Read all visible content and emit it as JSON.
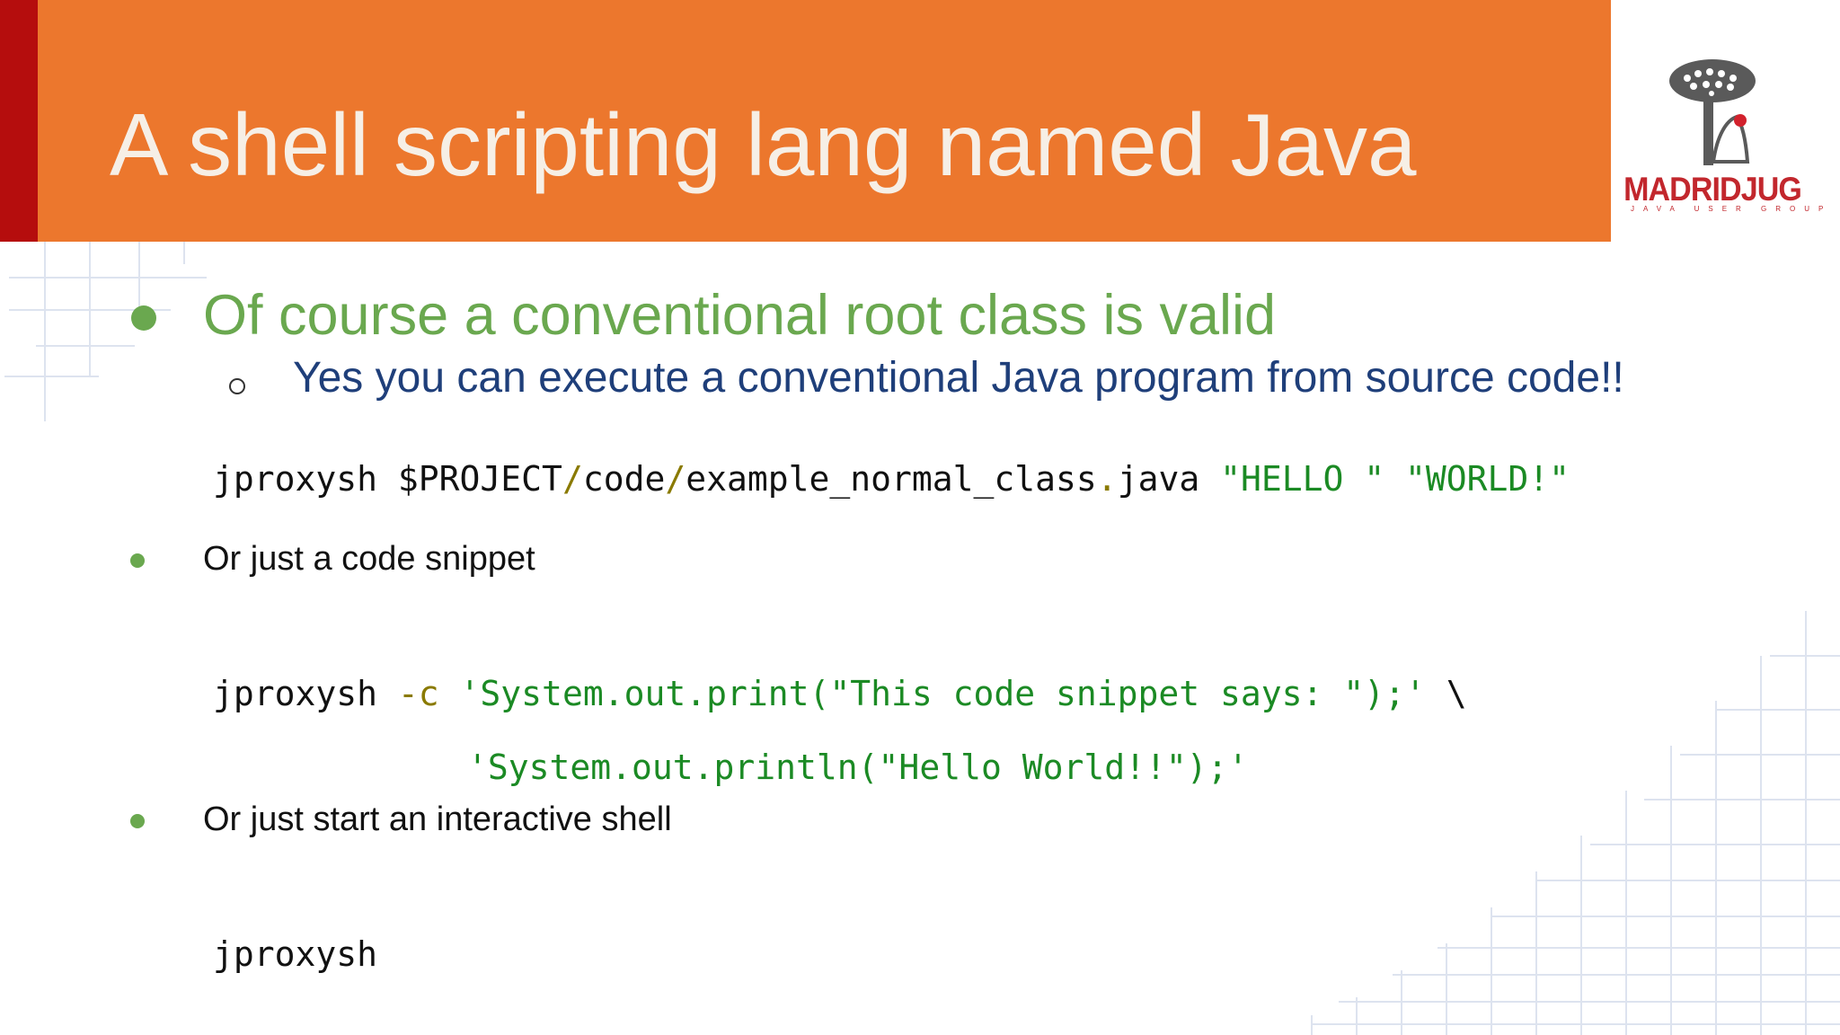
{
  "slide": {
    "title": "A shell scripting lang named Java",
    "logo": {
      "name": "MADRIDJUG",
      "sub": "JAVA USER GROUP"
    },
    "colors": {
      "header": "#ec772d",
      "accent": "#b50d0d",
      "bullet": "#6aa84f",
      "subtext": "#1f3f7a",
      "string": "#1b8a24"
    }
  },
  "content": {
    "bullet1": "Of course a conventional root class is valid",
    "sub1": "Yes you can execute a conventional Java program from source code!!",
    "code1": {
      "cmd": "jproxysh $PROJECT",
      "s1": "/",
      "p1": "code",
      "s2": "/",
      "p2": "example_normal_class",
      "dot": ".",
      "ext": "java ",
      "arg": "\"HELLO \" \"WORLD!\""
    },
    "bullet2": "Or just a code snippet",
    "code2": {
      "cmd": "jproxysh ",
      "flag": "-c",
      "arg1": " 'System.out.print(\"This code snippet says: \");'",
      "cont": " \\",
      "arg2": "'System.out.println(\"Hello World!!\");'"
    },
    "bullet3": "Or just start an interactive shell",
    "code3": "jproxysh"
  }
}
